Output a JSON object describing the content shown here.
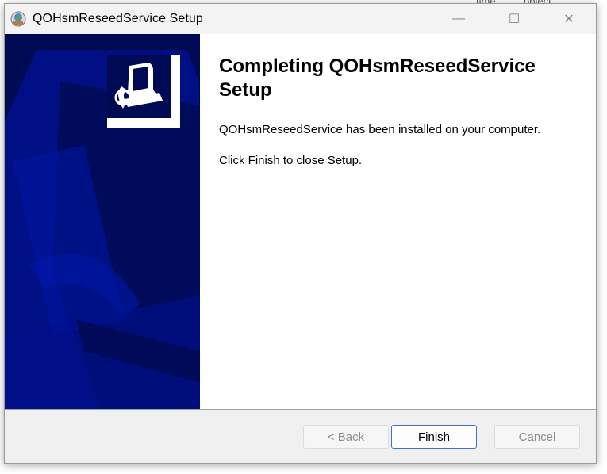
{
  "window": {
    "title": "QOHsmReseedService Setup",
    "controls": {
      "minimize": "—",
      "maximize": "☐",
      "close": "✕"
    }
  },
  "background_app": {
    "fragments": [
      "time",
      "object"
    ]
  },
  "wizard": {
    "heading_line1": "Completing QOHsmReseedService",
    "heading_line2": "Setup",
    "message_installed": "QOHsmReseedService has been installed on your computer.",
    "message_finish": "Click Finish to close Setup."
  },
  "buttons": {
    "back": "< Back",
    "finish": "Finish",
    "cancel": "Cancel"
  },
  "colors": {
    "banner": "#000a54",
    "banner_shape": "#00108a",
    "focus_border": "#3a73c9"
  },
  "icons": {
    "app": "installer-globe-icon",
    "product": "computer-install-icon"
  }
}
